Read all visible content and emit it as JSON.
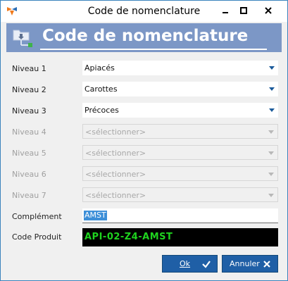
{
  "window": {
    "title": "Code de nomenclature"
  },
  "header": {
    "title": "Code de nomenclature"
  },
  "levels": [
    {
      "label": "Niveau 1",
      "value": "Apiacés"
    },
    {
      "label": "Niveau 2",
      "value": "Carottes"
    },
    {
      "label": "Niveau 3",
      "value": "Précoces"
    },
    {
      "label": "Niveau 4",
      "value": "<sélectionner>"
    },
    {
      "label": "Niveau 5",
      "value": "<sélectionner>"
    },
    {
      "label": "Niveau 6",
      "value": "<sélectionner>"
    },
    {
      "label": "Niveau 7",
      "value": "<sélectionner>"
    }
  ],
  "complement": {
    "label": "Complément",
    "value": "AMST"
  },
  "product_code": {
    "label": "Code Produit",
    "value": "API-02-Z4-AMST"
  },
  "buttons": {
    "ok_label": "Ok",
    "cancel_label": "Annuler"
  },
  "colors": {
    "banner": "#7c97c6",
    "button": "#1f5fa6",
    "code_text": "#1fd31f",
    "code_background": "#000000",
    "selection": "#3d8fd8"
  },
  "icons": {
    "app": "app-logo-icon",
    "banner": "hierarchy-icon",
    "ok": "checkmark-icon",
    "cancel": "close-x-icon"
  }
}
